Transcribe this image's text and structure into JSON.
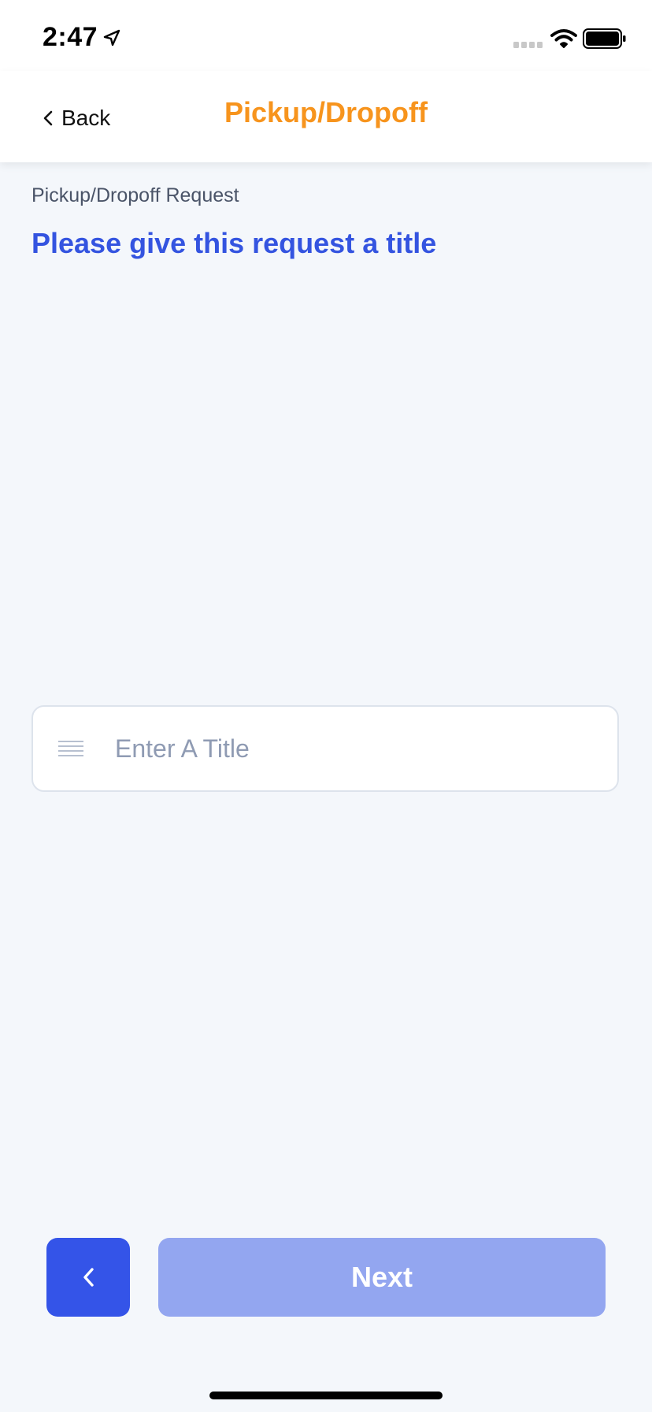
{
  "status_bar": {
    "time": "2:47",
    "icons": [
      "location-arrow-icon",
      "cellular-signal-icon",
      "wifi-icon",
      "battery-icon"
    ]
  },
  "nav": {
    "back_label": "Back",
    "title": "Pickup/Dropoff",
    "title_color": "#f7941d"
  },
  "form": {
    "section_label": "Pickup/Dropoff Request",
    "prompt": "Please give this request a title",
    "prompt_color": "#3454e0",
    "title_input": {
      "value": "",
      "placeholder": "Enter A Title",
      "icon": "text-lines-icon"
    }
  },
  "footer": {
    "prev_icon": "chevron-left-icon",
    "next_label": "Next",
    "prev_color": "#3454e8",
    "next_color": "#93a6f0"
  }
}
